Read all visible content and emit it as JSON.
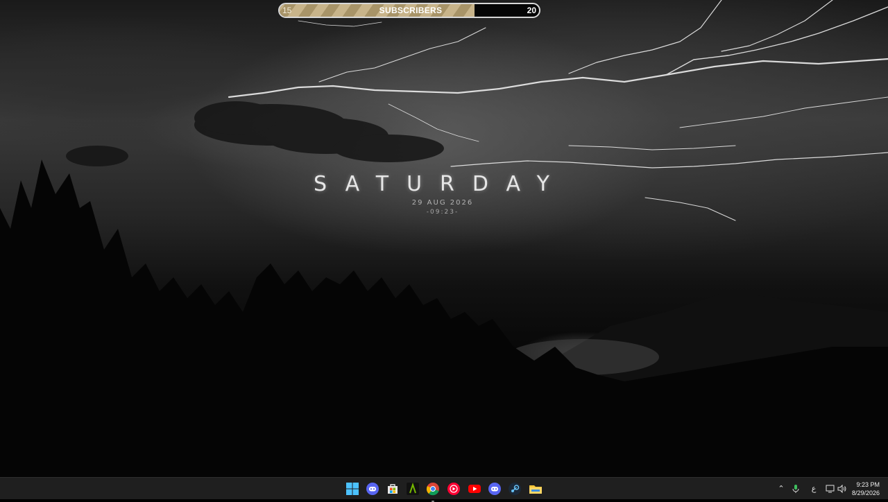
{
  "subscribers": {
    "start": "15",
    "label": "SUBSCRIBERS",
    "goal": "20",
    "progress_fraction": 0.75
  },
  "clock_widget": {
    "day": "SATURDAY",
    "date": "29 AUG 2026",
    "time": "-09:23-"
  },
  "taskbar": {
    "apps": [
      {
        "icon": "windows-start-icon"
      },
      {
        "icon": "discord-icon"
      },
      {
        "icon": "microsoft-store-icon"
      },
      {
        "icon": "nvidia-app-icon"
      },
      {
        "icon": "chrome-icon",
        "running": true
      },
      {
        "icon": "youtube-music-icon"
      },
      {
        "icon": "youtube-icon"
      },
      {
        "icon": "discord-icon"
      },
      {
        "icon": "steam-icon"
      },
      {
        "icon": "file-explorer-icon"
      }
    ],
    "tray": {
      "keyboard_indicator": "ع",
      "time": "9:23 PM",
      "date": "8/29/2026"
    }
  },
  "colors": {
    "bar_fill": "#c8b48a",
    "taskbar": "#1f1f1f"
  }
}
